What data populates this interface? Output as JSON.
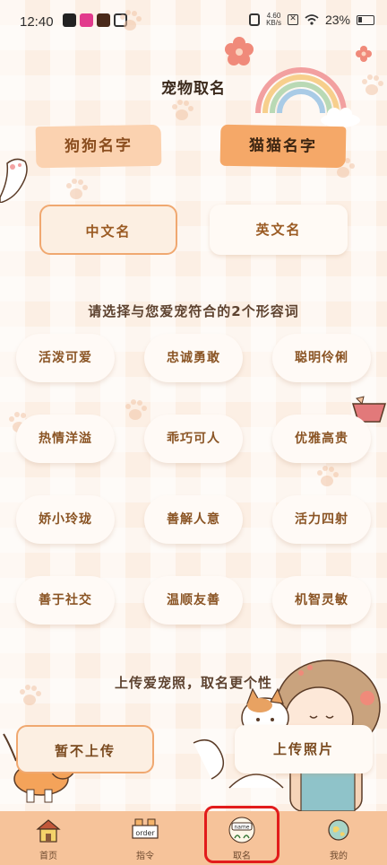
{
  "status_bar": {
    "time": "12:40",
    "net_speed": "4.60",
    "net_unit": "KB/s",
    "battery": "23%"
  },
  "header": {
    "title": "宠物取名"
  },
  "pet_tabs": [
    {
      "label": "狗狗名字",
      "selected": false
    },
    {
      "label": "猫猫名字",
      "selected": true
    }
  ],
  "name_language": [
    {
      "label": "中文名",
      "selected": true
    },
    {
      "label": "英文名",
      "selected": false
    }
  ],
  "prompt": "请选择与您爱宠符合的2个形容词",
  "adjectives": [
    "活泼可爱",
    "忠诚勇敢",
    "聪明伶俐",
    "热情洋溢",
    "乖巧可人",
    "优雅高贵",
    "娇小玲珑",
    "善解人意",
    "活力四射",
    "善于社交",
    "温顺友善",
    "机智灵敏"
  ],
  "upload": {
    "hint": "上传爱宠照，取名更个性",
    "skip_label": "暂不上传",
    "upload_label": "上传照片"
  },
  "bottom_nav": {
    "items": [
      {
        "label": "首页",
        "icon": "house-icon"
      },
      {
        "label": "指令",
        "icon": "order-sign-icon",
        "icon_text": "order"
      },
      {
        "label": "取名",
        "icon": "name-sign-icon",
        "icon_text": "name",
        "active": true
      },
      {
        "label": "我的",
        "icon": "globe-icon"
      }
    ]
  },
  "colors": {
    "accent": "#f5a868",
    "highlight": "#e21c1c"
  }
}
